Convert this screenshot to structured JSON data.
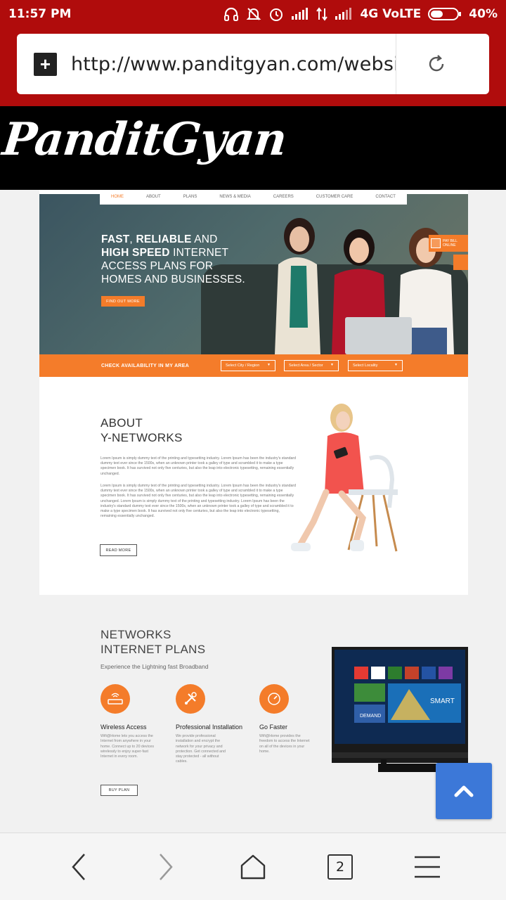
{
  "status_bar": {
    "time": "11:57 PM",
    "network": "4G VoLTE",
    "battery": "40%",
    "icons": [
      "headset-icon",
      "mute-icon",
      "alarm-icon",
      "signal-icon",
      "data-arrows-icon",
      "signal2-icon",
      "battery-icon"
    ]
  },
  "browser": {
    "url": "http://www.panditgyan.com/websites",
    "tab_count": "2"
  },
  "logo": {
    "text": "PanditGyan"
  },
  "site": {
    "nav": [
      "HOME",
      "ABOUT",
      "PLANS",
      "NEWS & MEDIA",
      "CAREERS",
      "CUSTOMER CARE",
      "CONTACT"
    ],
    "hero": {
      "line1_bold": "FAST",
      "line1_sep": ", ",
      "line1_bold2": "RELIABLE",
      "line1_rest": " AND",
      "line2_bold": "HIGH SPEED",
      "line2_rest": " INTERNET",
      "line3": "ACCESS PLANS FOR",
      "line4": "HOMES AND BUSINESSES.",
      "cta": "FIND OUT MORE",
      "pay_bill": "PAY BILL ONLINE"
    },
    "availability": {
      "label": "CHECK AVAILABILITY IN MY AREA",
      "select_city": "Select City / Region",
      "select_area": "Select Area / Sector",
      "select_locality": "Select Locality"
    },
    "about": {
      "title1": "ABOUT",
      "title2": "Y-NETWORKS",
      "p1": "Lorem Ipsum is simply dummy text of the printing and typesetting industry. Lorem Ipsum has been the industry's standard dummy text ever since the 1500s, when an unknown printer took a galley of type and scrambled it to make a type specimen book. It has survived not only five centuries, but also the leap into electronic typesetting, remaining essentially unchanged.",
      "p2": "Lorem Ipsum is simply dummy text of the printing and typesetting industry. Lorem Ipsum has been the industry's standard dummy text ever since the 1500s, when an unknown printer took a galley of type and scrambled it to make a type specimen book. It has survived not only five centuries, but also the leap into electronic typesetting, remaining essentially unchanged. Lorem Ipsum is simply dummy text of the printing and typesetting industry. Lorem Ipsum has been the industry's standard dummy text ever since the 1500s, when an unknown printer took a galley of type and scrambled it to make a type specimen book. It has survived not only five centuries, but also the leap into electronic typesetting, remaining essentially unchanged.",
      "button": "READ MORE"
    },
    "plans": {
      "title1": "NETWORKS",
      "title2": "INTERNET PLANS",
      "subtitle": "Experience the Lightning fast Broadband",
      "features": [
        {
          "title": "Wireless Access",
          "desc": "Wifi@Home lets you access the Internet from anywhere in your home. Connect up to 20 devices wirelessly to enjoy super-fast Internet in every room."
        },
        {
          "title": "Professional Installation",
          "desc": "We provide professional installation and encrypt the network for your privacy and protection. Get connected and stay protected - all without cables."
        },
        {
          "title": "Go Faster",
          "desc": "Wifi@Home provides the freedom to access the Internet on all of the devices in your home."
        }
      ],
      "button": "BUY PLAN",
      "tv_brand": "SMART",
      "tv_demand": "DEMAND"
    }
  },
  "colors": {
    "accent": "#f47c2a",
    "chrome": "#b00c0c",
    "scroll_button": "#3c78d8"
  }
}
